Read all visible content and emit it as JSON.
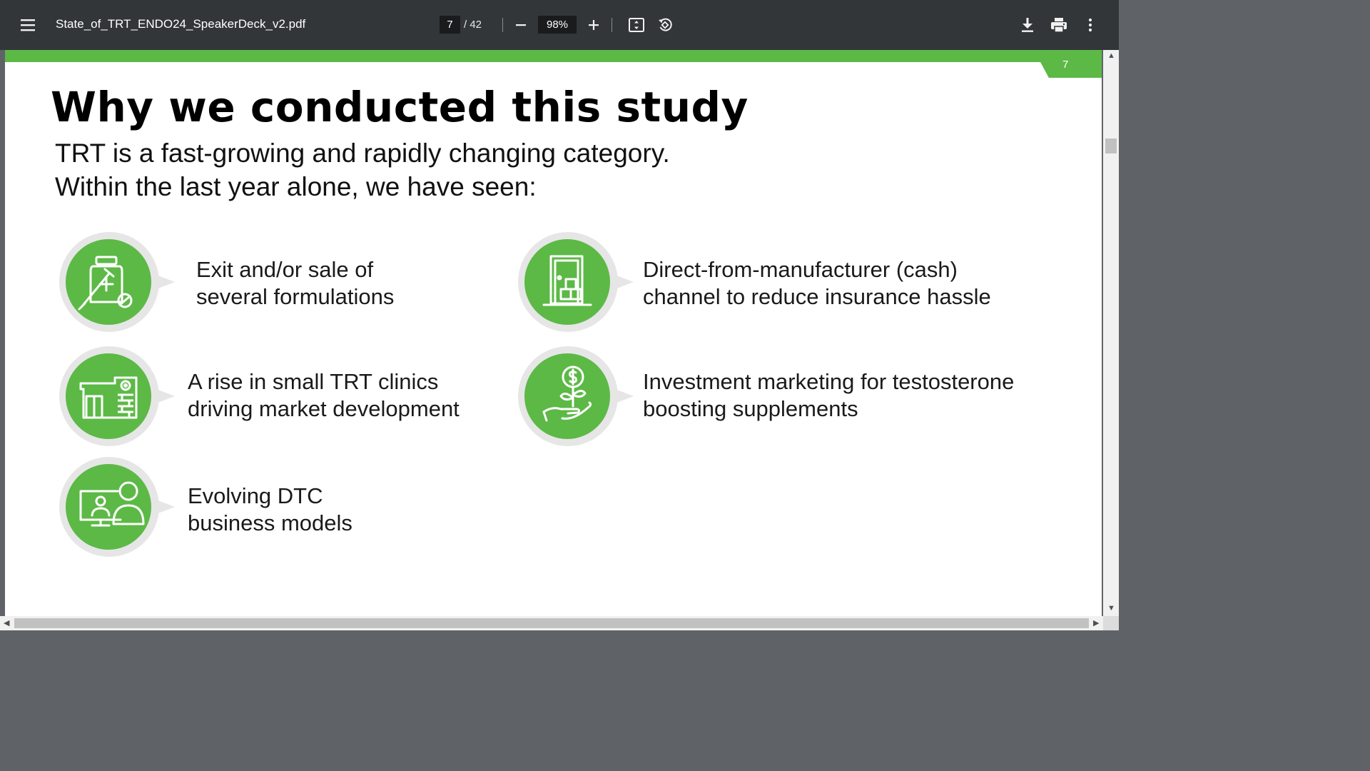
{
  "toolbar": {
    "file_name": "State_of_TRT_ENDO24_SpeakerDeck_v2.pdf",
    "current_page": "7",
    "page_total": "/ 42",
    "zoom": "98%",
    "icons": [
      "menu-icon",
      "zoom-out-icon",
      "zoom-in-icon",
      "fit-page-icon",
      "rotate-icon",
      "download-icon",
      "print-icon",
      "more-vert-icon"
    ]
  },
  "slide": {
    "page_number": "7",
    "title": "Why we conducted this study",
    "subtitle_line1": "TRT is a fast-growing and rapidly changing category.",
    "subtitle_line2": "Within the last year alone, we have seen:",
    "items": [
      {
        "line1": "Exit and/or sale of",
        "line2": "several formulations",
        "icon": "medication-vial-syringe-icon"
      },
      {
        "line1": "Direct-from-manufacturer (cash)",
        "line2": "channel to reduce insurance hassle",
        "icon": "door-boxes-icon"
      },
      {
        "line1": "A rise in small TRT clinics",
        "line2": "driving market development",
        "icon": "clinic-building-icon"
      },
      {
        "line1": "Investment marketing for testosterone",
        "line2": "boosting supplements",
        "icon": "hand-dollar-plant-icon"
      },
      {
        "line1": "Evolving DTC",
        "line2": "business models",
        "icon": "telehealth-monitor-icon"
      }
    ]
  },
  "colors": {
    "accent_green": "#5cb946",
    "toolbar_bg": "#323639",
    "viewer_bg": "#5f6368",
    "circle_halo": "#e6e6e6"
  }
}
